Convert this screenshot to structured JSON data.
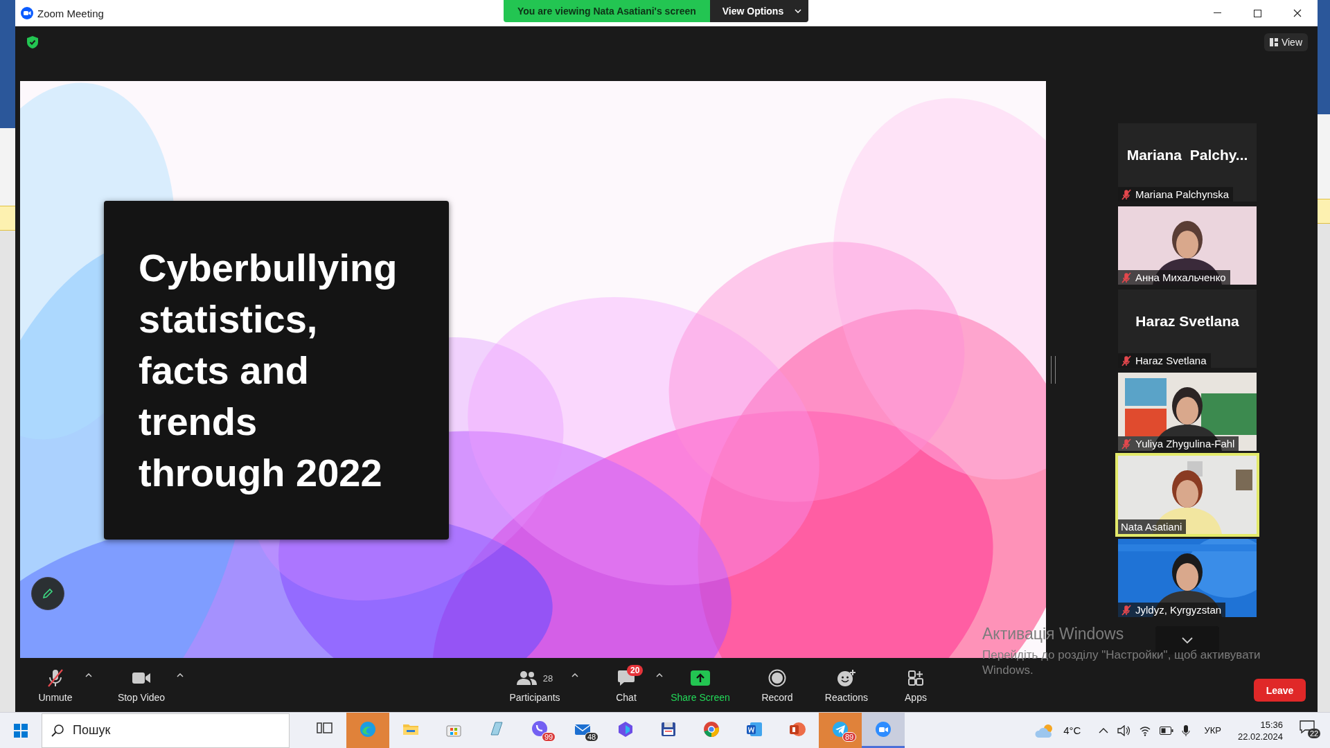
{
  "window": {
    "title": "Zoom Meeting"
  },
  "banner": {
    "text": "You are viewing Nata Asatiani's screen",
    "view_options": "View Options"
  },
  "view_button": "View",
  "slide": {
    "title_lines": [
      "Cyberbullying",
      "statistics,",
      "facts and",
      "trends",
      "through 2022"
    ]
  },
  "gallery": [
    {
      "name": "Mariana Palchynska",
      "display_name": "Mariana  Palchy...",
      "video": false,
      "muted": true,
      "speaking": false
    },
    {
      "name": "Анна Михальченко",
      "video": true,
      "muted": true,
      "speaking": false
    },
    {
      "name": "Haraz Svetlana",
      "display_name": "Haraz Svetlana",
      "video": false,
      "muted": true,
      "speaking": false
    },
    {
      "name": "Yuliya Zhygulina-Fahl",
      "video": true,
      "muted": true,
      "speaking": false
    },
    {
      "name": "Nata Asatiani",
      "video": true,
      "muted": false,
      "speaking": true
    },
    {
      "name": "Jyldyz, Kyrgyzstan",
      "video": true,
      "muted": true,
      "speaking": false
    }
  ],
  "activation": {
    "title": "Активація Windows",
    "text": "Перейдіть до розділу \"Настройки\", щоб активувати Windows."
  },
  "toolbar": [
    {
      "kind": "mic",
      "label": "Unmute",
      "muted": true,
      "caret": true
    },
    {
      "kind": "video",
      "label": "Stop Video",
      "caret": true
    },
    {
      "kind": "participants",
      "label": "Participants",
      "count": "28",
      "caret": true
    },
    {
      "kind": "chat",
      "label": "Chat",
      "badge": "20",
      "caret": true
    },
    {
      "kind": "share",
      "label": "Share Screen"
    },
    {
      "kind": "record",
      "label": "Record"
    },
    {
      "kind": "reactions",
      "label": "Reactions"
    },
    {
      "kind": "apps",
      "label": "Apps"
    }
  ],
  "leave": "Leave",
  "taskbar": {
    "search_placeholder": "Пошук",
    "apps": [
      {
        "kind": "taskview",
        "flashing": false,
        "active": false
      },
      {
        "kind": "edge",
        "flashing": true,
        "active": false
      },
      {
        "kind": "explorer",
        "flashing": false,
        "active": false
      },
      {
        "kind": "store",
        "flashing": false,
        "active": false
      },
      {
        "kind": "notebook",
        "flashing": false,
        "active": false
      },
      {
        "kind": "viber",
        "flashing": false,
        "active": false,
        "badge": "99"
      },
      {
        "kind": "mail",
        "flashing": false,
        "active": false,
        "badge": "48"
      },
      {
        "kind": "copilot",
        "flashing": false,
        "active": false
      },
      {
        "kind": "disk",
        "flashing": false,
        "active": false
      },
      {
        "kind": "chrome",
        "flashing": false,
        "active": false
      },
      {
        "kind": "word",
        "flashing": false,
        "active": false
      },
      {
        "kind": "powerpoint",
        "flashing": false,
        "active": false
      },
      {
        "kind": "telegram",
        "flashing": true,
        "active": false,
        "badge": "89"
      },
      {
        "kind": "zoom",
        "flashing": false,
        "active": true
      }
    ],
    "weather": "4°C",
    "language": "УКР",
    "time": "15:36",
    "date": "22.02.2024",
    "notifications": "22"
  }
}
